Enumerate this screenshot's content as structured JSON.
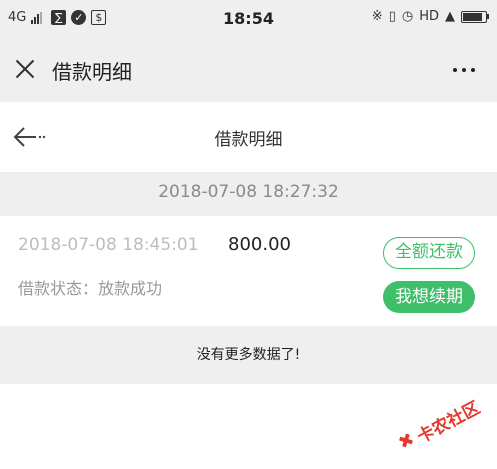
{
  "status_bar": {
    "network": "4G",
    "time": "18:54",
    "hd": "HD",
    "icons_left": [
      "signal-icon",
      "app-icon-1",
      "check-icon",
      "dollar-icon"
    ],
    "icons_right": [
      "bluetooth-icon",
      "vibrate-icon",
      "alarm-icon",
      "wifi-icon",
      "battery-icon"
    ]
  },
  "webview_bar": {
    "title": "借款明细",
    "close_icon": "close-icon",
    "more_icon": "more-icon"
  },
  "page_header": {
    "title": "借款明细",
    "back_icon": "back-arrow-icon"
  },
  "date_group": {
    "date": "2018-07-08 18:27:32"
  },
  "record": {
    "time": "2018-07-08 18:45:01",
    "amount": "800.00",
    "status": "借款状态：放款成功",
    "repay_label": "全额还款",
    "renew_label": "我想续期"
  },
  "footer": {
    "note": "没有更多数据了!"
  },
  "watermark": {
    "text": "卡农社区"
  },
  "colors": {
    "accent_green": "#3fbf6a",
    "watermark_red": "#e23b2e"
  }
}
